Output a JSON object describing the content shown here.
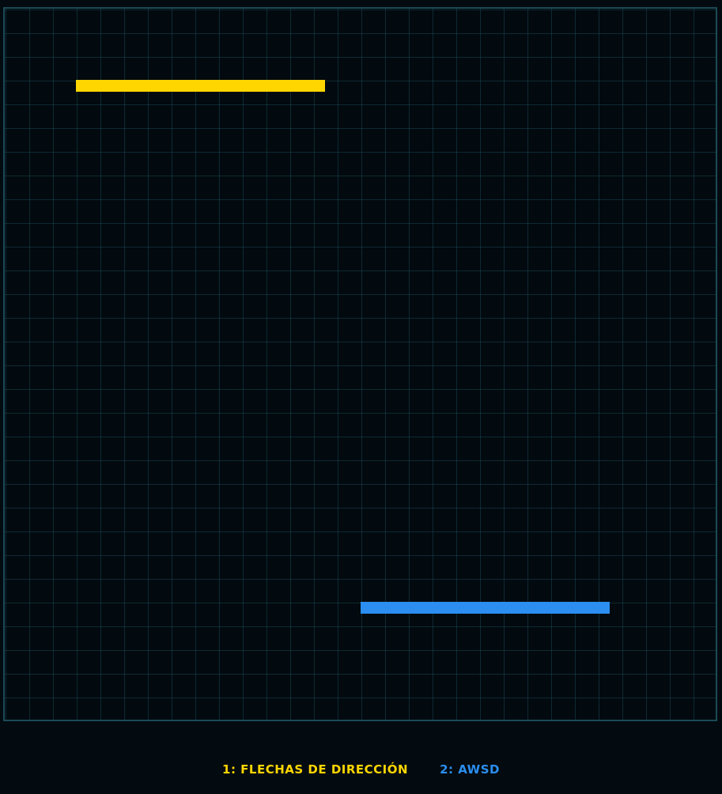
{
  "colors": {
    "background": "#030b10",
    "grid_line": "#1e505c",
    "border": "#1c4a56",
    "player1": "#ffd600",
    "player2": "#2b8ef0"
  },
  "legend": {
    "player1_label": "1: FLECHAS DE DIRECCIÓN",
    "player2_label": "2: AWSD"
  }
}
